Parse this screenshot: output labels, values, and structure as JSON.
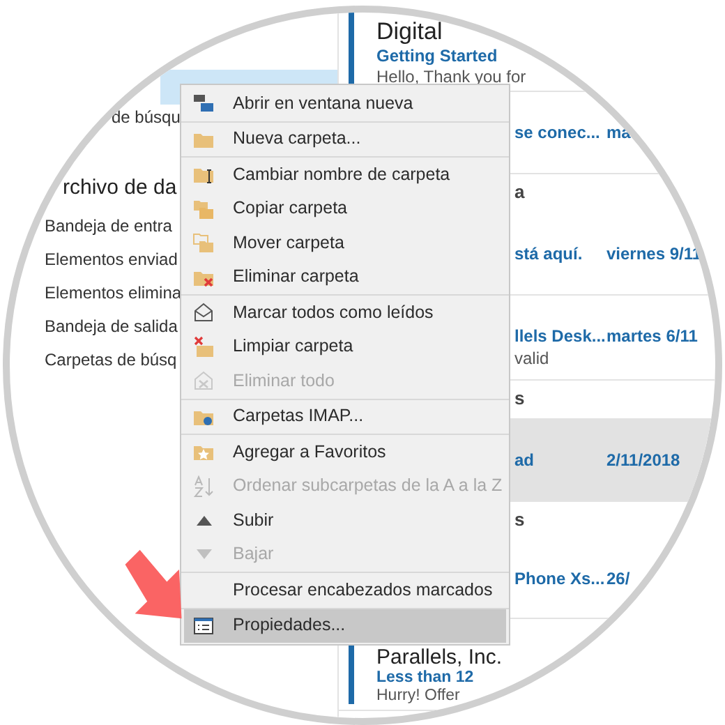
{
  "folders": {
    "partial_top": "de búsqu",
    "section": "rchivo de da",
    "items": [
      {
        "label": "Bandeja de entra",
        "selected": false
      },
      {
        "label": "Elementos enviad",
        "selected": false
      },
      {
        "label": "Elementos elimina",
        "selected": false
      },
      {
        "label": "Bandeja de salida",
        "selected": false
      },
      {
        "label": "Carpetas de búsq",
        "selected": false
      }
    ]
  },
  "messages": [
    {
      "sender": "Digital",
      "subject": "Getting Started",
      "preview": "Hello,  Thank you for",
      "unread": true,
      "selected": false
    },
    {
      "subject": "se conec...",
      "date": "ma",
      "selected": false
    },
    {
      "line_1": "a",
      "subject": "stá aquí.",
      "date": "viernes 9/11",
      "selected": false
    },
    {
      "subject": "llels Desk...",
      "date": "martes 6/11",
      "preview": "valid",
      "selected": false
    },
    {
      "line_1": "s",
      "subject": "ad",
      "date": "2/11/2018",
      "selected": true
    },
    {
      "line_1": "s",
      "subject": "Phone Xs...",
      "date": "26/",
      "selected": false
    },
    {
      "sender": "Parallels, Inc.",
      "subject": "Less than 12",
      "preview": "Hurry! Offer",
      "unread": true,
      "selected": false
    }
  ],
  "context_menu": {
    "groups": [
      [
        {
          "label": "Abrir en ventana nueva",
          "disabled": false,
          "selected": false
        }
      ],
      [
        {
          "label": "Nueva carpeta...",
          "disabled": false,
          "selected": false
        }
      ],
      [
        {
          "label": "Cambiar nombre de carpeta",
          "disabled": false,
          "selected": false
        },
        {
          "label": "Copiar carpeta",
          "disabled": false,
          "selected": false
        },
        {
          "label": "Mover carpeta",
          "disabled": false,
          "selected": false
        },
        {
          "label": "Eliminar carpeta",
          "disabled": false,
          "selected": false
        }
      ],
      [
        {
          "label": "Marcar todos como leídos",
          "disabled": false,
          "selected": false
        },
        {
          "label": "Limpiar carpeta",
          "disabled": false,
          "selected": false
        },
        {
          "label": "Eliminar todo",
          "disabled": true,
          "selected": false
        }
      ],
      [
        {
          "label": "Carpetas IMAP...",
          "disabled": false,
          "selected": false
        }
      ],
      [
        {
          "label": "Agregar a Favoritos",
          "disabled": false,
          "selected": false
        },
        {
          "label": "Ordenar subcarpetas de la A a la Z",
          "disabled": true,
          "selected": false
        },
        {
          "label": "Subir",
          "disabled": false,
          "selected": false
        },
        {
          "label": "Bajar",
          "disabled": true,
          "selected": false
        }
      ],
      [
        {
          "label": "Procesar encabezados marcados",
          "disabled": false,
          "selected": false
        }
      ],
      [
        {
          "label": "Propiedades...",
          "disabled": false,
          "selected": true
        }
      ]
    ]
  }
}
